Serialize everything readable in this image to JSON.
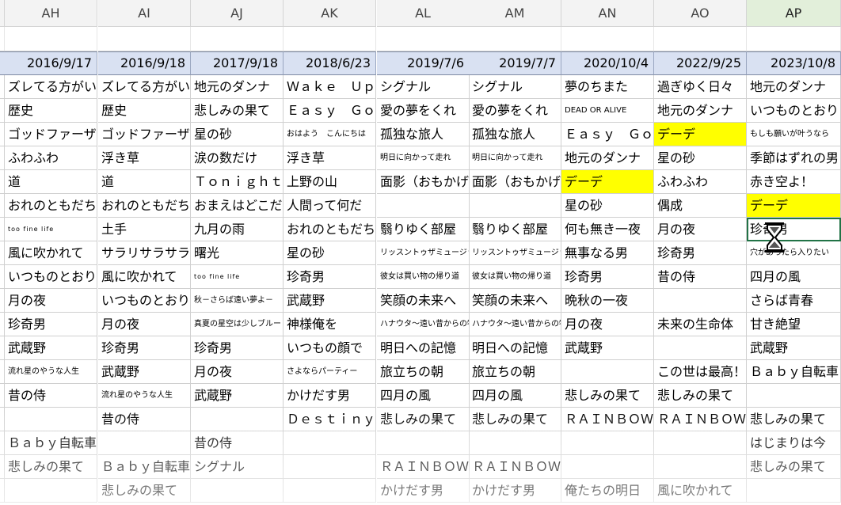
{
  "columns": [
    "AH",
    "AI",
    "AJ",
    "AK",
    "AL",
    "AM",
    "AN",
    "AO",
    "AP"
  ],
  "selected_column": "AP",
  "dates": [
    "2016/9/17",
    "2016/9/18",
    "2017/9/18",
    "2018/6/23",
    "2019/7/6",
    "2019/7/7",
    "2020/10/4",
    "2022/9/25",
    "2023/10/8"
  ],
  "rows": [
    [
      "ズレてる方がいい",
      "ズレてる方がいい",
      "地元のダンナ",
      "Ｗａｋｅ　Ｕｐ",
      "シグナル",
      "シグナル",
      "夢のちまた",
      "過ぎゆく日々",
      "地元のダンナ"
    ],
    [
      "歴史",
      "歴史",
      "悲しみの果て",
      "Ｅａｓｙ　Ｇｏ",
      "愛の夢をくれ",
      "愛の夢をくれ",
      "DEAD OR ALIVE",
      "地元のダンナ",
      "いつものとおり"
    ],
    [
      "ゴッドファーザー",
      "ゴッドファーザー",
      "星の砂",
      "おはよう　こんにちは",
      "孤独な旅人",
      "孤独な旅人",
      "Ｅａｓｙ　Ｇｏ",
      "デーデ",
      "もしも願いが叶うなら"
    ],
    [
      "ふわふわ",
      "浮き草",
      "涙の数だけ",
      "浮き草",
      "明日に向かって走れ",
      "明日に向かって走れ",
      "地元のダンナ",
      "星の砂",
      "季節はずれの男"
    ],
    [
      "道",
      "道",
      "Ｔｏｎｉｇｈｔ",
      "上野の山",
      "面影（おもかげ）",
      "面影（おもかげ）",
      "デーデ",
      "ふわふわ",
      "赤き空よ！"
    ],
    [
      "おれのともだち",
      "おれのともだち",
      "おまえはどこだ",
      "人間って何だ",
      "",
      "",
      "星の砂",
      "偶成",
      "デーデ"
    ],
    [
      "too fine life",
      "土手",
      "九月の雨",
      "おれのともだち",
      "翳りゆく部屋",
      "翳りゆく部屋",
      "何も無き一夜",
      "月の夜",
      "珍奇男"
    ],
    [
      "風に吹かれて",
      "サラリサラサラリ",
      "曙光",
      "星の砂",
      "リッスントゥザミュージック",
      "リッスントゥザミュージック",
      "無事なる男",
      "珍奇男",
      "穴があったら入りたい"
    ],
    [
      "いつものとおり",
      "風に吹かれて",
      "too fine life",
      "珍奇男",
      "彼女は買い物の帰り道",
      "彼女は買い物の帰り道",
      "珍奇男",
      "昔の侍",
      "四月の風"
    ],
    [
      "月の夜",
      "いつものとおり",
      "秋－さらば遠い夢よ－",
      "武蔵野",
      "笑顔の未来へ",
      "笑顔の未来へ",
      "晩秋の一夜",
      "",
      "さらば青春"
    ],
    [
      "珍奇男",
      "月の夜",
      "真夏の星空は少しブルー",
      "神様俺を",
      "ハナウタ～遠い昔からの物語～",
      "ハナウタ～遠い昔からの物語～",
      "月の夜",
      "未来の生命体",
      "甘き絶望"
    ],
    [
      "武蔵野",
      "珍奇男",
      "珍奇男",
      "いつもの顔で",
      "明日への記憶",
      "明日への記憶",
      "武蔵野",
      "",
      "武蔵野"
    ],
    [
      "流れ星のやうな人生",
      "武蔵野",
      "月の夜",
      "さよならパーティー",
      "旅立ちの朝",
      "旅立ちの朝",
      "",
      "この世は最高！",
      "Ｂａｂｙ自転車"
    ],
    [
      "昔の侍",
      "流れ星のやうな人生",
      "武蔵野",
      "かけだす男",
      "四月の風",
      "四月の風",
      "悲しみの果て",
      "悲しみの果て",
      ""
    ],
    [
      "",
      "昔の侍",
      "",
      "Ｄｅｓｔｉｎｙ",
      "悲しみの果て",
      "悲しみの果て",
      "ＲＡＩＮＢＯＷ",
      "ＲＡＩＮＢＯＷ",
      "悲しみの果て"
    ],
    [
      "Ｂａｂｙ自転車",
      "",
      "昔の侍",
      "",
      "",
      "",
      "",
      "",
      "はじまりは今"
    ],
    [
      "悲しみの果て",
      "Ｂａｂｙ自転車",
      "シグナル",
      "",
      "ＲＡＩＮＢＯＷ",
      "ＲＡＩＮＢＯＷ",
      "",
      "",
      "悲しみの果て"
    ],
    [
      "",
      "悲しみの果て",
      "",
      "",
      "かけだす男",
      "かけだす男",
      "俺たちの明日",
      "風に吹かれて",
      ""
    ]
  ],
  "highlighted": {
    "r2c7": true,
    "r4c6": true,
    "r5c8": true
  },
  "selected_cell": "r6c8",
  "colors": {
    "header_bg": "#f3f3f3",
    "date_bg": "#d9e1f2",
    "highlight": "#ffff00",
    "select": "#217346"
  },
  "cursor_icon": "hourglass-icon"
}
